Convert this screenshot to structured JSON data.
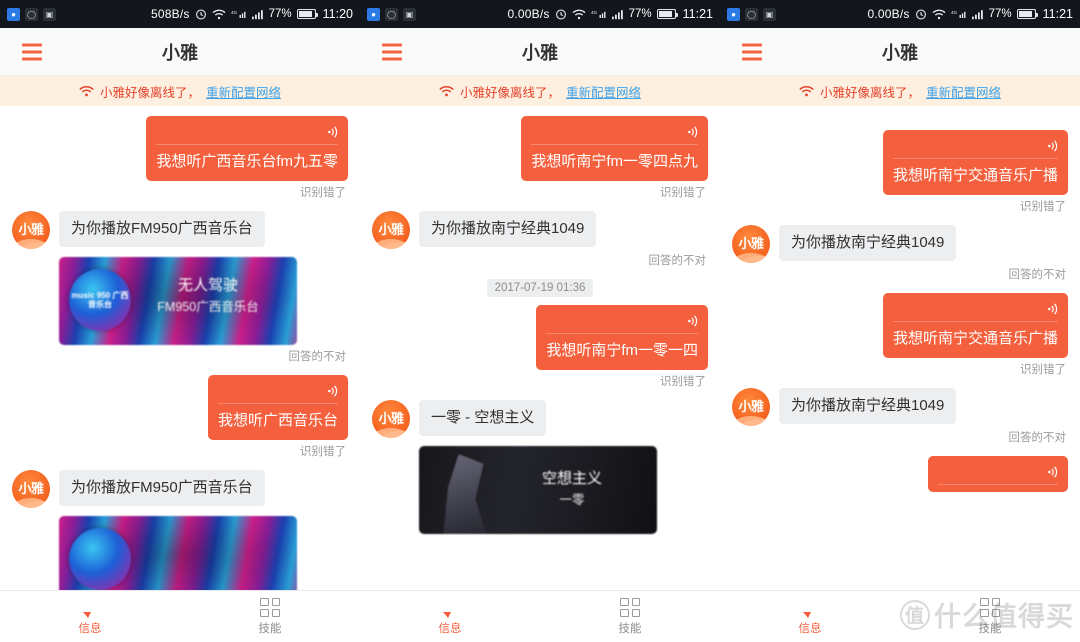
{
  "panels": [
    {
      "status": {
        "icons": [
          "shield-icon",
          "clock-icon",
          "card-icon"
        ],
        "speed": "508B/s",
        "alarm": "alarm-icon",
        "wifi": "wifi-icon",
        "data": "4g-icon",
        "signal": "signal-icon",
        "battery_pct": "77%",
        "battery": "battery-icon",
        "time": "11:20"
      },
      "header": {
        "menu": "hamburger-icon",
        "title": "小雅"
      },
      "banner": {
        "icon": "wifi-offline-icon",
        "text": "小雅好像离线了，",
        "link": "重新配置网络"
      },
      "messages": [
        {
          "type": "user",
          "text": "我想听广西音乐台fm九五零",
          "feedback": "识别错了"
        },
        {
          "type": "bot",
          "avatar": "小雅",
          "text": "为你播放FM950广西音乐台"
        },
        {
          "type": "card-radio",
          "title": "无人驾驶",
          "subtitle": "FM950广西音乐台",
          "logo": "music 950 广西音乐台",
          "feedback": "回答的不对"
        },
        {
          "type": "user",
          "text": "我想听广西音乐台",
          "feedback": "识别错了"
        },
        {
          "type": "bot",
          "avatar": "小雅",
          "text": "为你播放FM950广西音乐台"
        },
        {
          "type": "card-radio-partial",
          "title": "",
          "subtitle": "",
          "logo": ""
        }
      ],
      "tabs": [
        {
          "icon": "chat-icon",
          "label": "信息",
          "active": true
        },
        {
          "icon": "grid-icon",
          "label": "技能",
          "active": false
        }
      ]
    },
    {
      "status": {
        "icons": [
          "shield-icon",
          "clock-icon",
          "card-icon"
        ],
        "speed": "0.00B/s",
        "alarm": "alarm-icon",
        "wifi": "wifi-icon",
        "data": "4g-icon",
        "signal": "signal-icon",
        "battery_pct": "77%",
        "battery": "battery-icon",
        "time": "11:21"
      },
      "header": {
        "menu": "hamburger-icon",
        "title": "小雅"
      },
      "banner": {
        "icon": "wifi-offline-icon",
        "text": "小雅好像离线了，",
        "link": "重新配置网络"
      },
      "messages": [
        {
          "type": "user",
          "text": "我想听南宁fm一零四点九",
          "feedback": "识别错了"
        },
        {
          "type": "bot",
          "avatar": "小雅",
          "text": "为你播放南宁经典1049",
          "feedback": "回答的不对"
        },
        {
          "type": "timestamp",
          "text": "2017-07-19 01:36"
        },
        {
          "type": "user",
          "text": "我想听南宁fm一零一四",
          "feedback": "识别错了"
        },
        {
          "type": "bot",
          "avatar": "小雅",
          "text": "一零 - 空想主义"
        },
        {
          "type": "card-music",
          "title": "空想主义",
          "subtitle": "一零"
        }
      ],
      "tabs": [
        {
          "icon": "chat-icon",
          "label": "信息",
          "active": true
        },
        {
          "icon": "grid-icon",
          "label": "技能",
          "active": false
        }
      ]
    },
    {
      "status": {
        "icons": [
          "shield-icon",
          "clock-icon",
          "card-icon"
        ],
        "speed": "0.00B/s",
        "alarm": "alarm-icon",
        "wifi": "wifi-icon",
        "data": "4g-icon",
        "signal": "signal-icon",
        "battery_pct": "77%",
        "battery": "battery-icon",
        "time": "11:21"
      },
      "header": {
        "menu": "hamburger-icon",
        "title": "小雅"
      },
      "banner": {
        "icon": "wifi-offline-icon",
        "text": "小雅好像离线了，",
        "link": "重新配置网络"
      },
      "messages": [
        {
          "type": "user",
          "text": "我想听南宁交通音乐广播",
          "feedback": "识别错了"
        },
        {
          "type": "bot",
          "avatar": "小雅",
          "text": "为你播放南宁经典1049",
          "feedback": "回答的不对"
        },
        {
          "type": "user",
          "text": "我想听南宁交通音乐广播",
          "feedback": "识别错了"
        },
        {
          "type": "bot",
          "avatar": "小雅",
          "text": "为你播放南宁经典1049",
          "feedback": "回答的不对"
        },
        {
          "type": "user-partial",
          "text": ""
        }
      ],
      "tabs": [
        {
          "icon": "chat-icon",
          "label": "信息",
          "active": true
        },
        {
          "icon": "grid-icon",
          "label": "技能",
          "active": false
        }
      ]
    }
  ],
  "watermark": {
    "mark": "值",
    "text": "什么值得买"
  },
  "colors": {
    "accent": "#f4603d",
    "banner_bg": "#fdf0e0",
    "banner_text": "#e8402a",
    "link": "#3fa0e8",
    "bot_bubble": "#eceef0",
    "statusbar": "#13161c"
  }
}
